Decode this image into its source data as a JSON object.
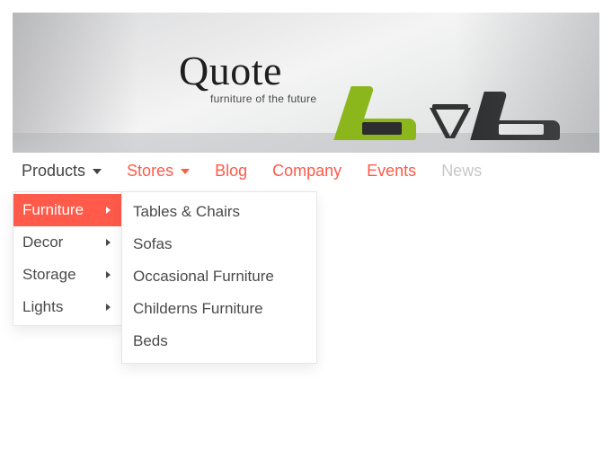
{
  "brand": {
    "name": "Quote",
    "tagline": "furniture of the future"
  },
  "nav": {
    "products": "Products",
    "stores": "Stores",
    "blog": "Blog",
    "company": "Company",
    "events": "Events",
    "news": "News"
  },
  "menu_l1": {
    "furniture": "Furniture",
    "decor": "Decor",
    "storage": "Storage",
    "lights": "Lights"
  },
  "menu_l2": {
    "tables_chairs": "Tables & Chairs",
    "sofas": "Sofas",
    "occasional": "Occasional Furniture",
    "childerns": "Childerns Furniture",
    "beds": "Beds"
  },
  "colors": {
    "accent": "#ff5a4a"
  }
}
